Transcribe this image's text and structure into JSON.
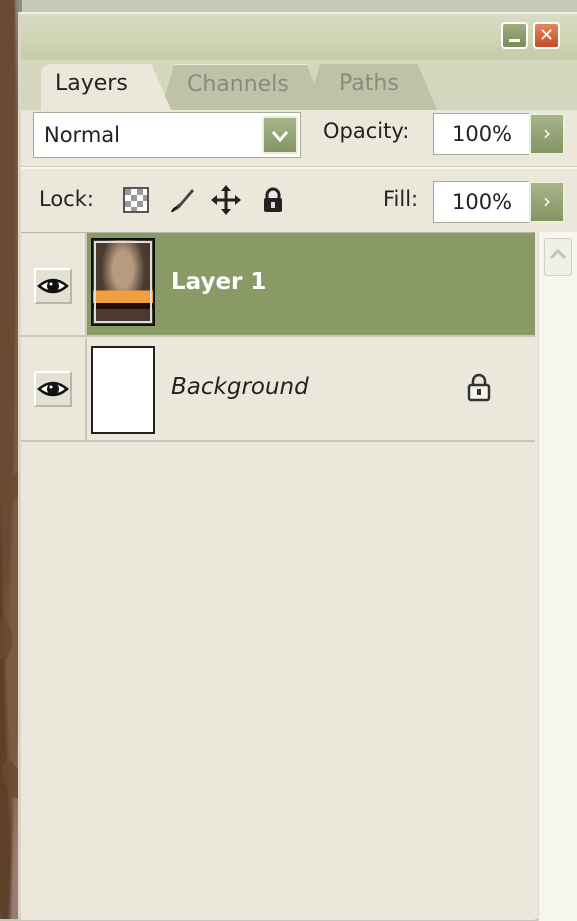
{
  "panel": {
    "tabs": [
      {
        "label": "Layers",
        "active": true
      },
      {
        "label": "Channels",
        "active": false
      },
      {
        "label": "Paths",
        "active": false
      }
    ],
    "menu_icon": "play-circle-icon",
    "close_label": "✕"
  },
  "controls": {
    "blend_mode": "Normal",
    "opacity_label": "Opacity:",
    "opacity_value": "100%",
    "lock_label": "Lock:",
    "fill_label": "Fill:",
    "fill_value": "100%"
  },
  "layers": [
    {
      "name": "Layer 1",
      "visible": true,
      "selected": true,
      "locked": false
    },
    {
      "name": "Background",
      "visible": true,
      "selected": false,
      "locked": true
    }
  ],
  "colors": {
    "selected_row": "#8a9a67",
    "panel_bg": "#ebe8db",
    "accent_button": "#849463",
    "close_button": "#c24c2b"
  }
}
